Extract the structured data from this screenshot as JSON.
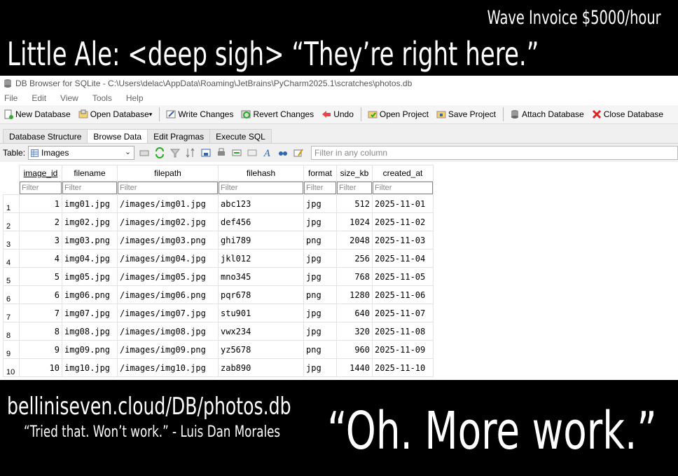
{
  "captions": {
    "top_right": "Wave Invoice $5000/hour",
    "headline": "Little Ale:  <deep sigh> “They’re right here.”",
    "url": "belliniseven.cloud/DB/photos.db",
    "quote": "“Tried that.  Won’t work.” - Luis Dan Morales",
    "big_quote": "“Oh.  More work.”"
  },
  "window": {
    "title": "DB Browser for SQLite - C:\\Users\\delac\\AppData\\Roaming\\JetBrains\\PyCharm2025.1\\scratches\\photos.db"
  },
  "menu": [
    "File",
    "Edit",
    "View",
    "Tools",
    "Help"
  ],
  "toolbar": {
    "new_database": "New Database",
    "open_database": "Open Database",
    "write_changes": "Write Changes",
    "revert_changes": "Revert Changes",
    "undo": "Undo",
    "open_project": "Open Project",
    "save_project": "Save Project",
    "attach_database": "Attach Database",
    "close_database": "Close Database"
  },
  "tabs": [
    "Database Structure",
    "Browse Data",
    "Edit Pragmas",
    "Execute SQL"
  ],
  "browse": {
    "table_label": "Table:",
    "table_selected": "Images",
    "global_filter_placeholder": "Filter in any column",
    "filter_placeholder": "Filter"
  },
  "columns": [
    "image_id",
    "filename",
    "filepath",
    "filehash",
    "format",
    "size_kb",
    "created_at"
  ],
  "rows": [
    [
      "1",
      "img01.jpg",
      "/images/img01.jpg",
      "abc123",
      "jpg",
      "512",
      "2025-11-01"
    ],
    [
      "2",
      "img02.jpg",
      "/images/img02.jpg",
      "def456",
      "jpg",
      "1024",
      "2025-11-02"
    ],
    [
      "3",
      "img03.png",
      "/images/img03.png",
      "ghi789",
      "png",
      "2048",
      "2025-11-03"
    ],
    [
      "4",
      "img04.jpg",
      "/images/img04.jpg",
      "jkl012",
      "jpg",
      "256",
      "2025-11-04"
    ],
    [
      "5",
      "img05.jpg",
      "/images/img05.jpg",
      "mno345",
      "jpg",
      "768",
      "2025-11-05"
    ],
    [
      "6",
      "img06.png",
      "/images/img06.png",
      "pqr678",
      "png",
      "1280",
      "2025-11-06"
    ],
    [
      "7",
      "img07.jpg",
      "/images/img07.jpg",
      "stu901",
      "jpg",
      "640",
      "2025-11-07"
    ],
    [
      "8",
      "img08.jpg",
      "/images/img08.jpg",
      "vwx234",
      "jpg",
      "320",
      "2025-11-08"
    ],
    [
      "9",
      "img09.png",
      "/images/img09.png",
      "yz5678",
      "png",
      "960",
      "2025-11-09"
    ],
    [
      "10",
      "img10.jpg",
      "/images/img10.jpg",
      "zab890",
      "jpg",
      "1440",
      "2025-11-10"
    ]
  ],
  "row_numbers": [
    "1",
    "2",
    "3",
    "4",
    "5",
    "6",
    "7",
    "8",
    "9",
    "10"
  ]
}
